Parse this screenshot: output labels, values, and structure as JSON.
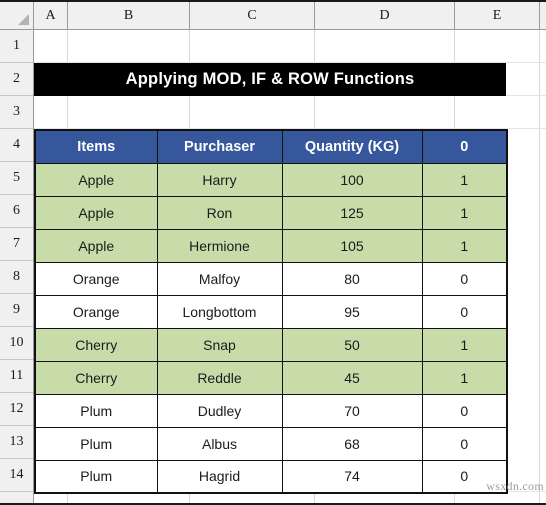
{
  "spreadsheet": {
    "corner_icon": "select-all-triangle-icon",
    "column_headers": [
      "A",
      "B",
      "C",
      "D",
      "E"
    ],
    "row_headers": [
      "1",
      "2",
      "3",
      "4",
      "5",
      "6",
      "7",
      "8",
      "9",
      "10",
      "11",
      "12",
      "13",
      "14"
    ],
    "title_banner": {
      "text": "Applying MOD, IF & ROW Functions",
      "background": "#000000",
      "color": "#ffffff"
    },
    "table": {
      "header_background": "#36579B",
      "header_color": "#ffffff",
      "highlight_background": "#C8DCA9",
      "plain_background": "#ffffff",
      "columns": [
        "Items",
        "Purchaser",
        "Quantity (KG)",
        "0"
      ],
      "rows": [
        {
          "items": "Apple",
          "purchaser": "Harry",
          "quantity": "100",
          "flag": "1",
          "highlighted": true
        },
        {
          "items": "Apple",
          "purchaser": "Ron",
          "quantity": "125",
          "flag": "1",
          "highlighted": true
        },
        {
          "items": "Apple",
          "purchaser": "Hermione",
          "quantity": "105",
          "flag": "1",
          "highlighted": true
        },
        {
          "items": "Orange",
          "purchaser": "Malfoy",
          "quantity": "80",
          "flag": "0",
          "highlighted": false
        },
        {
          "items": "Orange",
          "purchaser": "Longbottom",
          "quantity": "95",
          "flag": "0",
          "highlighted": false
        },
        {
          "items": "Cherry",
          "purchaser": "Snap",
          "quantity": "50",
          "flag": "1",
          "highlighted": true
        },
        {
          "items": "Cherry",
          "purchaser": "Reddle",
          "quantity": "45",
          "flag": "1",
          "highlighted": true
        },
        {
          "items": "Plum",
          "purchaser": "Dudley",
          "quantity": "70",
          "flag": "0",
          "highlighted": false
        },
        {
          "items": "Plum",
          "purchaser": "Albus",
          "quantity": "68",
          "flag": "0",
          "highlighted": false
        },
        {
          "items": "Plum",
          "purchaser": "Hagrid",
          "quantity": "74",
          "flag": "0",
          "highlighted": false
        }
      ]
    },
    "watermark": "wsxdn.com"
  }
}
